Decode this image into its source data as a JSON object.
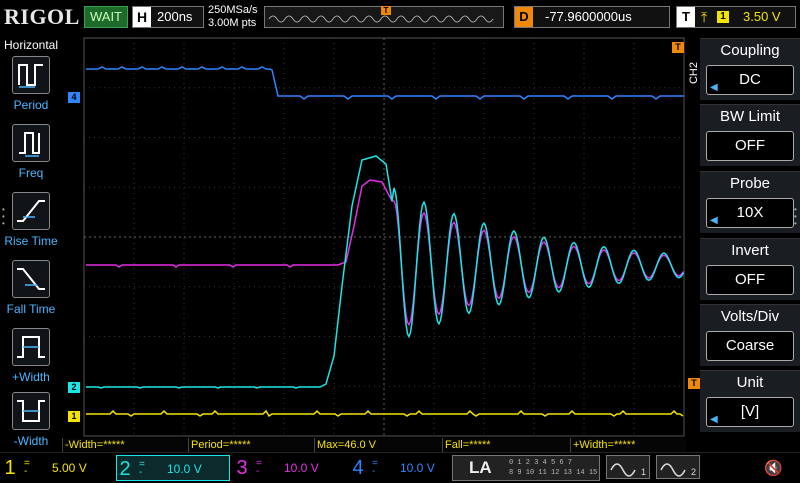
{
  "topbar": {
    "logo": "RIGOL",
    "status": "WAIT",
    "horizontal_label": "H",
    "timebase": "200ns",
    "sample_rate": "250MSa/s",
    "memory_depth": "3.00M pts",
    "delay_label": "D",
    "delay_value": "-77.9600000us",
    "trigger_label": "T",
    "trigger_slope_icon": "rising-edge-icon",
    "trigger_channel": "1",
    "trigger_level": "3.50 V"
  },
  "left_menu": {
    "title": "Horizontal",
    "items": [
      {
        "label": "Period",
        "icon": "period-icon"
      },
      {
        "label": "Freq",
        "icon": "frequency-icon"
      },
      {
        "label": "Rise Time",
        "icon": "rise-time-icon"
      },
      {
        "label": "Fall Time",
        "icon": "fall-time-icon"
      },
      {
        "label": "+Width",
        "icon": "positive-width-icon"
      },
      {
        "label": "-Width",
        "icon": "negative-width-icon"
      }
    ]
  },
  "right_menu": {
    "channel_tag": "CH2",
    "items": [
      {
        "title": "Coupling",
        "value": "DC"
      },
      {
        "title": "BW Limit",
        "value": "OFF"
      },
      {
        "title": "Probe",
        "value": "10X"
      },
      {
        "title": "Invert",
        "value": "OFF"
      },
      {
        "title": "Volts/Div",
        "value": "Coarse"
      },
      {
        "title": "Unit",
        "value": "[V]"
      }
    ]
  },
  "markers": {
    "ch4": "4",
    "ch2": "2",
    "ch1": "1",
    "trigger_pos": "T"
  },
  "measurements": [
    {
      "label": "-Width=*****"
    },
    {
      "label": "Period=*****"
    },
    {
      "label": "Max=46.0 V"
    },
    {
      "label": "Fall=*****"
    },
    {
      "label": "+Width=*****"
    }
  ],
  "channels": [
    {
      "num": "1",
      "scale": "5.00 V",
      "color": "#f5e300"
    },
    {
      "num": "2",
      "scale": "10.0 V",
      "color": "#19e6e6"
    },
    {
      "num": "3",
      "scale": "10.0 V",
      "color": "#e62ee6"
    },
    {
      "num": "4",
      "scale": "10.0 V",
      "color": "#2f86ff"
    }
  ],
  "la": {
    "label": "LA",
    "row1": "0 1 2 3  4 5 6 7",
    "row2": "8 9 10 11  12 13 14 15"
  },
  "generators": [
    {
      "num": "1"
    },
    {
      "num": "2"
    }
  ],
  "speaker_icon": "speaker-muted-icon"
}
